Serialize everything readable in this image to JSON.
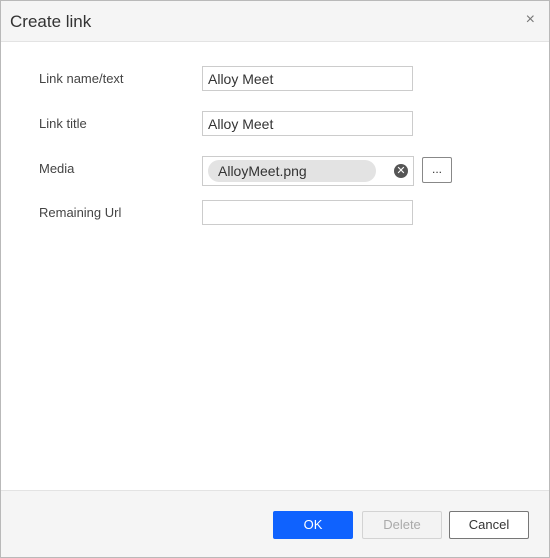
{
  "dialog": {
    "title": "Create link",
    "close_symbol": "×"
  },
  "form": {
    "link_name_label": "Link name/text",
    "link_name_value": "Alloy Meet",
    "link_title_label": "Link title",
    "link_title_value": "Alloy Meet",
    "media_label": "Media",
    "media_value": "AlloyMeet.png",
    "media_clear_icon": "clear-icon",
    "browse_label": "...",
    "remaining_url_label": "Remaining Url",
    "remaining_url_value": ""
  },
  "footer": {
    "ok_label": "OK",
    "delete_label": "Delete",
    "cancel_label": "Cancel"
  },
  "colors": {
    "primary": "#0f62fe",
    "header_bg": "#f5f5f5"
  }
}
